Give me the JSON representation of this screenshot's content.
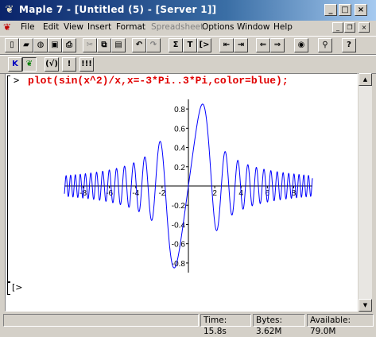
{
  "window": {
    "title": "Maple 7 - [Untitled (5) - [Server 1]]",
    "app_icon": "maple-leaf-icon"
  },
  "menu": [
    "File",
    "Edit",
    "View",
    "Insert",
    "Format",
    "Spreadsheet",
    "Options",
    "Window",
    "Help"
  ],
  "menu_disabled": [
    "Spreadsheet"
  ],
  "toolbar_row1": [
    "new",
    "open",
    "open-url",
    "save",
    "print",
    "cut",
    "copy",
    "paste",
    "undo",
    "redo",
    "sigma",
    "T",
    "exec-group",
    "outdent",
    "indent",
    "back",
    "forward",
    "stop",
    "zoom",
    "help"
  ],
  "toolbar_row2": {
    "k_label": "K",
    "fn_label": "(√)",
    "bang_label": "!",
    "bangs_label": "!!!"
  },
  "worksheet": {
    "prompt": ">",
    "command": "plot(sin(x^2)/x,x=-3*Pi..3*Pi,color=blue);",
    "prompt2": "[>"
  },
  "chart_data": {
    "type": "line",
    "function": "sin(x^2)/x",
    "x_range": [
      -9.42477796,
      9.42477796
    ],
    "ylim": [
      -0.9,
      0.9
    ],
    "color": "#0000ff",
    "x_ticks": [
      "-8",
      "-6",
      "-4",
      "-2",
      "2",
      "4",
      "6",
      "8"
    ],
    "y_ticks": [
      "0.8",
      "0.6",
      "0.4",
      "0.2",
      "-0.2",
      "-0.4",
      "-0.6",
      "-0.8"
    ]
  },
  "status": {
    "time": "Time: 15.8s",
    "bytes": "Bytes: 3.62M",
    "available": "Available: 79.0M"
  }
}
